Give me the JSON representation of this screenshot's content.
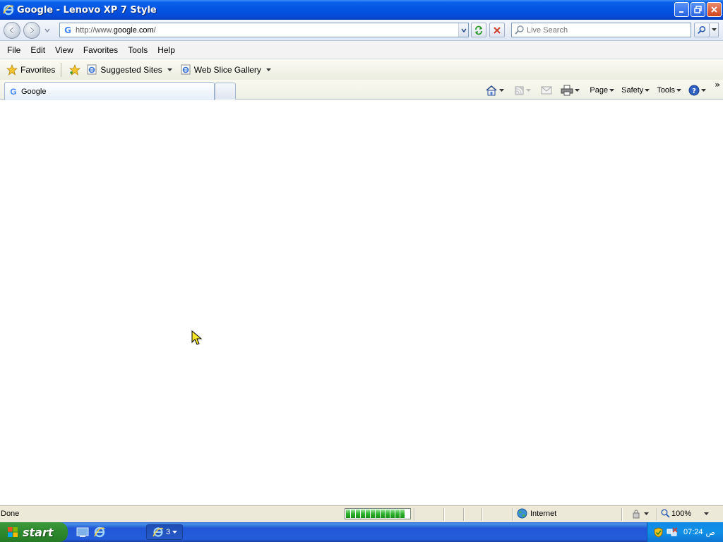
{
  "window": {
    "title": "Google - Lenovo XP 7 Style"
  },
  "navbar": {
    "address_favicon": "G",
    "url_prefix": "http://www.",
    "url_domain": "google.com",
    "url_suffix": "/",
    "search_placeholder": "Live Search"
  },
  "menubar": {
    "items": [
      "File",
      "Edit",
      "View",
      "Favorites",
      "Tools",
      "Help"
    ]
  },
  "favorites_bar": {
    "favorites_label": "Favorites",
    "links": [
      "Suggested Sites",
      "Web Slice Gallery"
    ]
  },
  "tabs": {
    "active_favicon": "G",
    "active_label": "Google"
  },
  "command_bar": {
    "page_label": "Page",
    "safety_label": "Safety",
    "tools_label": "Tools",
    "overflow": "»"
  },
  "status_bar": {
    "status": "Done",
    "progress_segments": 12,
    "zone_label": "Internet",
    "zoom_label": "100%"
  },
  "taskbar": {
    "start_label": "start",
    "group_count": "3",
    "time": "07:24",
    "ampm": "ص"
  },
  "colors": {
    "titlebar": "#0554e3",
    "start": "#2f8a2f",
    "tray": "#1190e8",
    "progress": "#2fb22f"
  },
  "icons": {
    "title": "ie-icon",
    "back": "back-arrow-icon",
    "forward": "forward-arrow-icon",
    "refresh": "refresh-icon",
    "stop": "stop-icon",
    "search": "magnifier-icon",
    "home": "home-icon",
    "feeds": "rss-icon",
    "mail": "mail-icon",
    "print": "printer-icon",
    "help": "help-icon",
    "zone": "globe-icon",
    "zoom": "zoom-icon"
  }
}
